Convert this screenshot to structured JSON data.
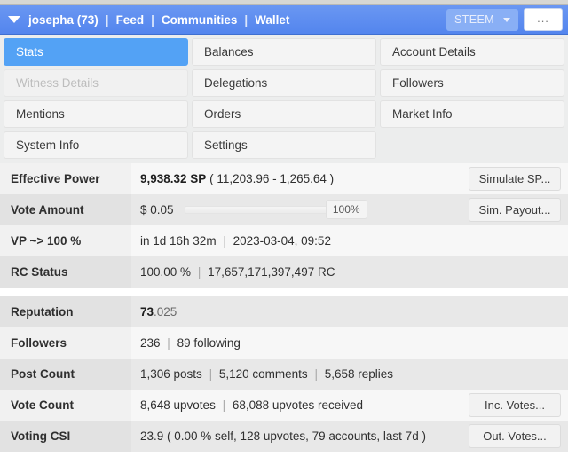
{
  "header": {
    "caret_icon": "caret-down-icon",
    "links": [
      "josepha (73)",
      "Feed",
      "Communities",
      "Wallet"
    ],
    "separator": "|",
    "currency_selector": {
      "label": "STEEM",
      "caret_icon": "caret-down-icon"
    },
    "more_button": "..."
  },
  "tabs": [
    {
      "label": "Stats",
      "state": "active"
    },
    {
      "label": "Balances",
      "state": "normal"
    },
    {
      "label": "Account Details",
      "state": "normal"
    },
    {
      "label": "Witness Details",
      "state": "disabled"
    },
    {
      "label": "Delegations",
      "state": "normal"
    },
    {
      "label": "Followers",
      "state": "normal"
    },
    {
      "label": "Mentions",
      "state": "normal"
    },
    {
      "label": "Orders",
      "state": "normal"
    },
    {
      "label": "Market Info",
      "state": "normal"
    },
    {
      "label": "System Info",
      "state": "normal"
    },
    {
      "label": "Settings",
      "state": "normal"
    },
    {
      "label": "",
      "state": "empty"
    }
  ],
  "stats": {
    "effective_power": {
      "label": "Effective Power",
      "value_strong": "9,938.32 SP",
      "value_rest": "( 11,203.96 - 1,265.64 )",
      "action": "Simulate SP..."
    },
    "vote_amount": {
      "label": "Vote Amount",
      "value": "$ 0.05",
      "slider_percent": "100%",
      "action": "Sim. Payout..."
    },
    "vp": {
      "label": "VP ~> 100 %",
      "time_remaining": "in 1d 16h 32m",
      "timestamp": "2023-03-04, 09:52"
    },
    "rc_status": {
      "label": "RC Status",
      "percent": "100.00 %",
      "amount": "17,657,171,397,497 RC"
    },
    "reputation": {
      "label": "Reputation",
      "value_strong": "73",
      "value_rest": ".025"
    },
    "followers": {
      "label": "Followers",
      "count": "236",
      "following": "89 following"
    },
    "post_count": {
      "label": "Post Count",
      "posts": "1,306 posts",
      "comments": "5,120 comments",
      "replies": "5,658 replies"
    },
    "vote_count": {
      "label": "Vote Count",
      "given": "8,648 upvotes",
      "received": "68,088 upvotes received",
      "action": "Inc. Votes..."
    },
    "voting_csi": {
      "label": "Voting CSI",
      "value": "23.9 ( 0.00 % self, 128 upvotes, 79 accounts, last 7d )",
      "action": "Out. Votes..."
    }
  },
  "colors": {
    "header_blue": "#5b8ef0",
    "active_tab_blue": "#53a2f5",
    "row_light": "#f7f7f7",
    "row_dark": "#e8e8e8"
  }
}
